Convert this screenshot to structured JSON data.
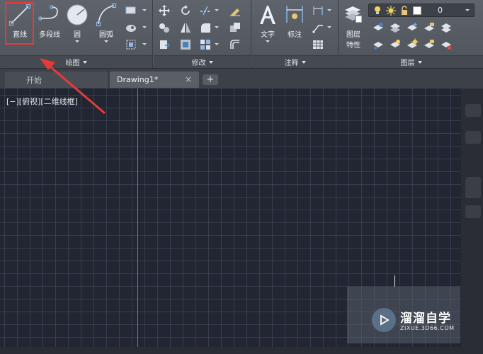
{
  "ribbon": {
    "draw_panel": {
      "title": "绘图",
      "tools": {
        "line": "直线",
        "polyline": "多段线",
        "circle": "圆",
        "arc": "圆弧"
      }
    },
    "modify_panel": {
      "title": "修改"
    },
    "annotation_panel": {
      "title": "注释",
      "tools": {
        "text": "文字",
        "dimension": "标注"
      }
    },
    "layers_panel": {
      "title": "图层",
      "tools": {
        "layer_properties_line1": "图层",
        "layer_properties_line2": "特性"
      },
      "current_layer": "0"
    }
  },
  "tabs": {
    "start": "开始",
    "drawing": "Drawing1*",
    "close": "×",
    "add": "+"
  },
  "viewport": {
    "label": "[−][俯视][二维线框]"
  },
  "watermark": {
    "title": "溜溜自学",
    "url": "ZIXUE.3D66.COM"
  },
  "colors": {
    "canvas_bg": "#212632",
    "grid": "#465060",
    "y_axis": "#3aa84a",
    "highlight": "#e63a3a",
    "ribbon": "#565b63"
  }
}
